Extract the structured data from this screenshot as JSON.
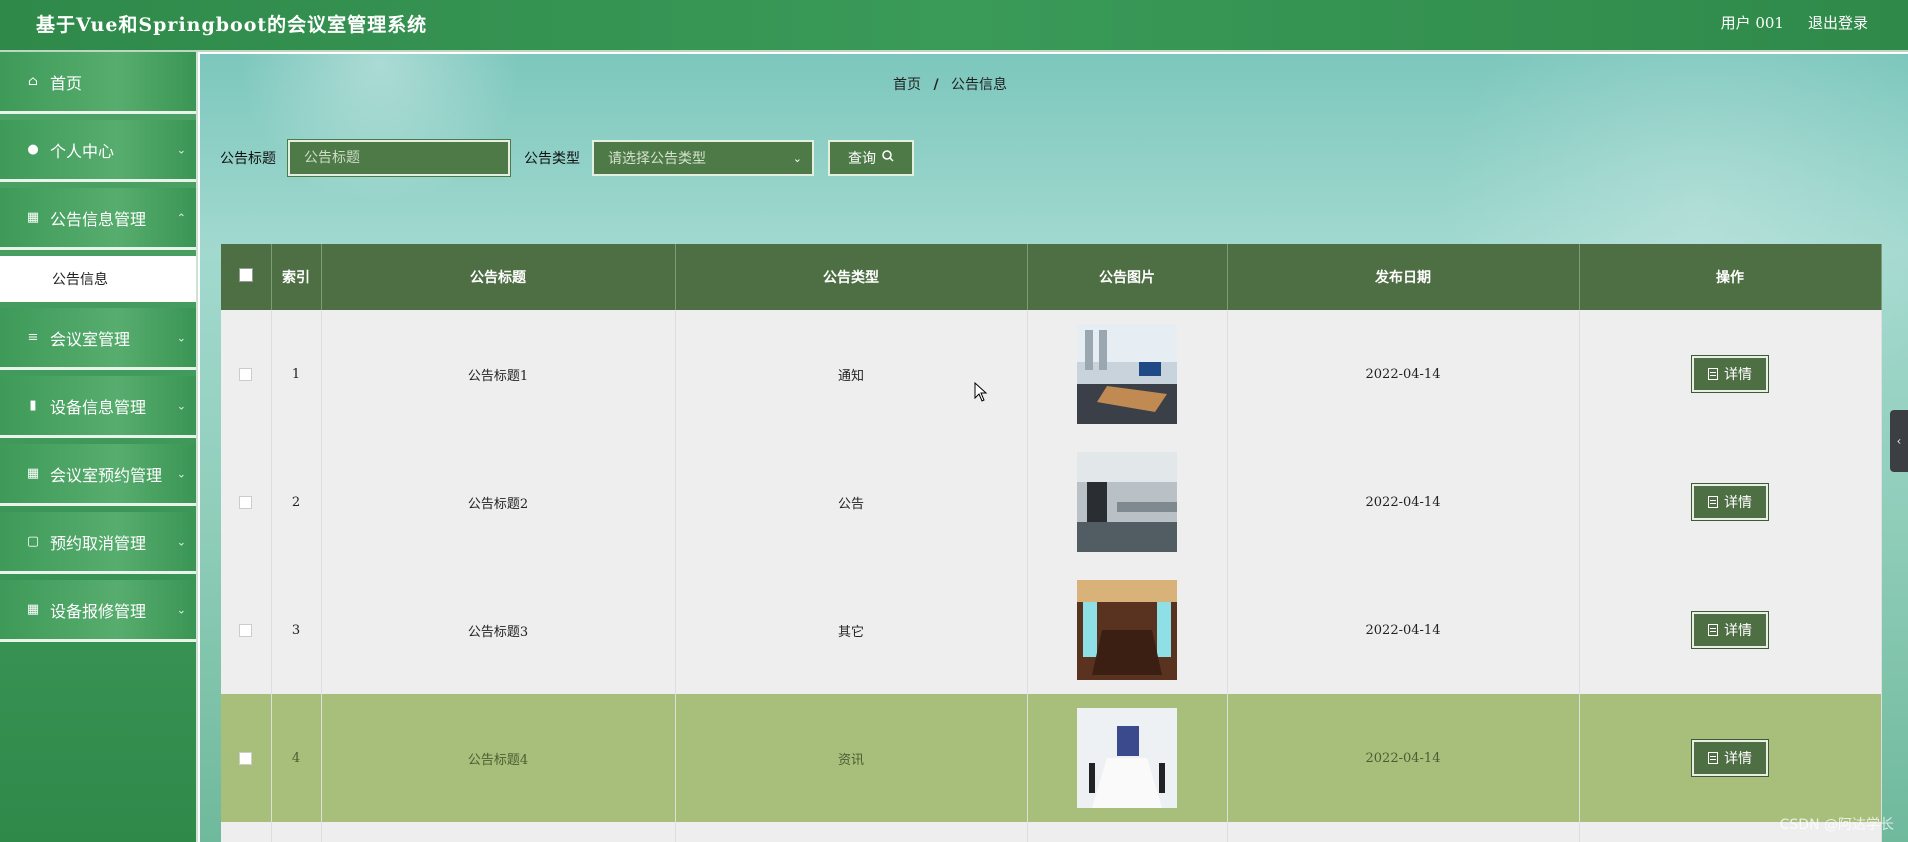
{
  "header": {
    "title": "基于Vue和Springboot的会议室管理系统",
    "user": "用户 001",
    "logout": "退出登录"
  },
  "sidebar": {
    "items": [
      {
        "label": "首页",
        "icon": "home-icon",
        "expandable": false
      },
      {
        "label": "个人中心",
        "icon": "user-icon",
        "expandable": true
      },
      {
        "label": "公告信息管理",
        "icon": "grid-icon",
        "expandable": true,
        "children": [
          "公告信息"
        ]
      },
      {
        "label": "会议室管理",
        "icon": "list-icon",
        "expandable": true
      },
      {
        "label": "设备信息管理",
        "icon": "chart-icon",
        "expandable": true
      },
      {
        "label": "会议室预约管理",
        "icon": "grid-icon",
        "expandable": true
      },
      {
        "label": "预约取消管理",
        "icon": "clipboard-icon",
        "expandable": true
      },
      {
        "label": "设备报修管理",
        "icon": "grid-icon",
        "expandable": true
      }
    ]
  },
  "breadcrumb": {
    "home": "首页",
    "sep": "/",
    "current": "公告信息"
  },
  "search": {
    "title_label": "公告标题",
    "title_placeholder": "公告标题",
    "type_label": "公告类型",
    "type_placeholder": "请选择公告类型",
    "query_button": "查询"
  },
  "table": {
    "headers": [
      "索引",
      "公告标题",
      "公告类型",
      "公告图片",
      "发布日期",
      "操作"
    ],
    "rows": [
      {
        "index": "1",
        "title": "公告标题1",
        "type": "通知",
        "date": "2022-04-14",
        "action": "详情"
      },
      {
        "index": "2",
        "title": "公告标题2",
        "type": "公告",
        "date": "2022-04-14",
        "action": "详情"
      },
      {
        "index": "3",
        "title": "公告标题3",
        "type": "其它",
        "date": "2022-04-14",
        "action": "详情"
      },
      {
        "index": "4",
        "title": "公告标题4",
        "type": "资讯",
        "date": "2022-04-14",
        "action": "详情"
      }
    ]
  },
  "watermark": "CSDN @阿达学长",
  "colors": {
    "header_green": "#2f8a4a",
    "table_header": "#4e6e44",
    "row_highlight": "#a8bf7b",
    "button_bg": "#4e7a48"
  }
}
